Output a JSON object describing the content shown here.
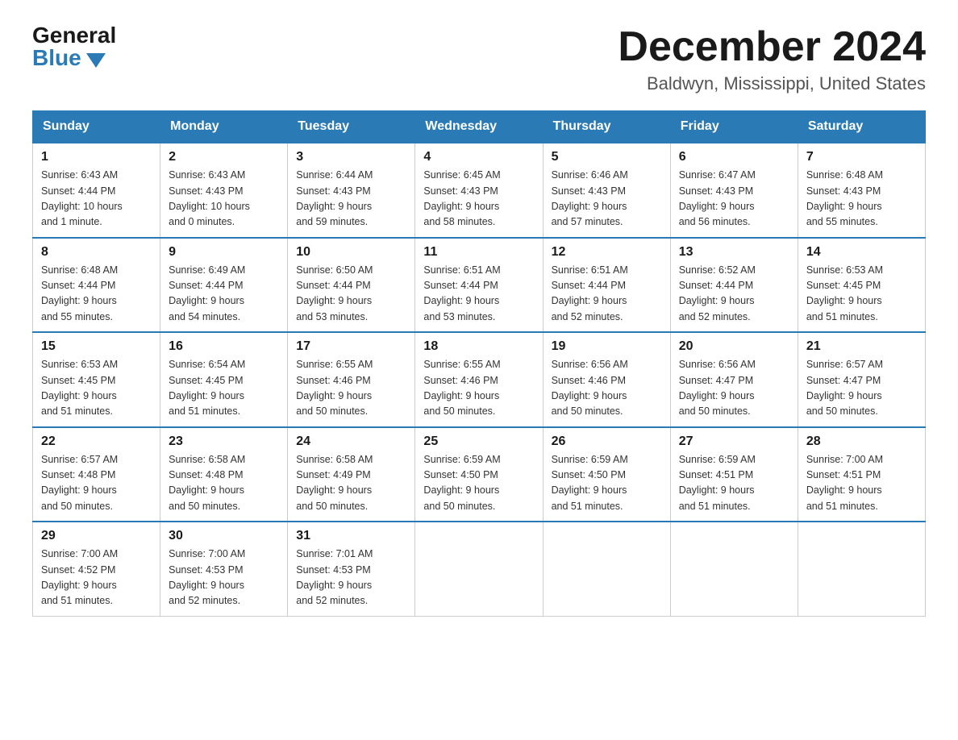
{
  "logo": {
    "general": "General",
    "blue": "Blue"
  },
  "header": {
    "month_title": "December 2024",
    "location": "Baldwyn, Mississippi, United States"
  },
  "weekdays": [
    "Sunday",
    "Monday",
    "Tuesday",
    "Wednesday",
    "Thursday",
    "Friday",
    "Saturday"
  ],
  "weeks": [
    [
      {
        "day": "1",
        "sunrise": "6:43 AM",
        "sunset": "4:44 PM",
        "daylight": "10 hours and 1 minute."
      },
      {
        "day": "2",
        "sunrise": "6:43 AM",
        "sunset": "4:43 PM",
        "daylight": "10 hours and 0 minutes."
      },
      {
        "day": "3",
        "sunrise": "6:44 AM",
        "sunset": "4:43 PM",
        "daylight": "9 hours and 59 minutes."
      },
      {
        "day": "4",
        "sunrise": "6:45 AM",
        "sunset": "4:43 PM",
        "daylight": "9 hours and 58 minutes."
      },
      {
        "day": "5",
        "sunrise": "6:46 AM",
        "sunset": "4:43 PM",
        "daylight": "9 hours and 57 minutes."
      },
      {
        "day": "6",
        "sunrise": "6:47 AM",
        "sunset": "4:43 PM",
        "daylight": "9 hours and 56 minutes."
      },
      {
        "day": "7",
        "sunrise": "6:48 AM",
        "sunset": "4:43 PM",
        "daylight": "9 hours and 55 minutes."
      }
    ],
    [
      {
        "day": "8",
        "sunrise": "6:48 AM",
        "sunset": "4:44 PM",
        "daylight": "9 hours and 55 minutes."
      },
      {
        "day": "9",
        "sunrise": "6:49 AM",
        "sunset": "4:44 PM",
        "daylight": "9 hours and 54 minutes."
      },
      {
        "day": "10",
        "sunrise": "6:50 AM",
        "sunset": "4:44 PM",
        "daylight": "9 hours and 53 minutes."
      },
      {
        "day": "11",
        "sunrise": "6:51 AM",
        "sunset": "4:44 PM",
        "daylight": "9 hours and 53 minutes."
      },
      {
        "day": "12",
        "sunrise": "6:51 AM",
        "sunset": "4:44 PM",
        "daylight": "9 hours and 52 minutes."
      },
      {
        "day": "13",
        "sunrise": "6:52 AM",
        "sunset": "4:44 PM",
        "daylight": "9 hours and 52 minutes."
      },
      {
        "day": "14",
        "sunrise": "6:53 AM",
        "sunset": "4:45 PM",
        "daylight": "9 hours and 51 minutes."
      }
    ],
    [
      {
        "day": "15",
        "sunrise": "6:53 AM",
        "sunset": "4:45 PM",
        "daylight": "9 hours and 51 minutes."
      },
      {
        "day": "16",
        "sunrise": "6:54 AM",
        "sunset": "4:45 PM",
        "daylight": "9 hours and 51 minutes."
      },
      {
        "day": "17",
        "sunrise": "6:55 AM",
        "sunset": "4:46 PM",
        "daylight": "9 hours and 50 minutes."
      },
      {
        "day": "18",
        "sunrise": "6:55 AM",
        "sunset": "4:46 PM",
        "daylight": "9 hours and 50 minutes."
      },
      {
        "day": "19",
        "sunrise": "6:56 AM",
        "sunset": "4:46 PM",
        "daylight": "9 hours and 50 minutes."
      },
      {
        "day": "20",
        "sunrise": "6:56 AM",
        "sunset": "4:47 PM",
        "daylight": "9 hours and 50 minutes."
      },
      {
        "day": "21",
        "sunrise": "6:57 AM",
        "sunset": "4:47 PM",
        "daylight": "9 hours and 50 minutes."
      }
    ],
    [
      {
        "day": "22",
        "sunrise": "6:57 AM",
        "sunset": "4:48 PM",
        "daylight": "9 hours and 50 minutes."
      },
      {
        "day": "23",
        "sunrise": "6:58 AM",
        "sunset": "4:48 PM",
        "daylight": "9 hours and 50 minutes."
      },
      {
        "day": "24",
        "sunrise": "6:58 AM",
        "sunset": "4:49 PM",
        "daylight": "9 hours and 50 minutes."
      },
      {
        "day": "25",
        "sunrise": "6:59 AM",
        "sunset": "4:50 PM",
        "daylight": "9 hours and 50 minutes."
      },
      {
        "day": "26",
        "sunrise": "6:59 AM",
        "sunset": "4:50 PM",
        "daylight": "9 hours and 51 minutes."
      },
      {
        "day": "27",
        "sunrise": "6:59 AM",
        "sunset": "4:51 PM",
        "daylight": "9 hours and 51 minutes."
      },
      {
        "day": "28",
        "sunrise": "7:00 AM",
        "sunset": "4:51 PM",
        "daylight": "9 hours and 51 minutes."
      }
    ],
    [
      {
        "day": "29",
        "sunrise": "7:00 AM",
        "sunset": "4:52 PM",
        "daylight": "9 hours and 51 minutes."
      },
      {
        "day": "30",
        "sunrise": "7:00 AM",
        "sunset": "4:53 PM",
        "daylight": "9 hours and 52 minutes."
      },
      {
        "day": "31",
        "sunrise": "7:01 AM",
        "sunset": "4:53 PM",
        "daylight": "9 hours and 52 minutes."
      },
      null,
      null,
      null,
      null
    ]
  ],
  "labels": {
    "sunrise": "Sunrise:",
    "sunset": "Sunset:",
    "daylight": "Daylight:"
  }
}
